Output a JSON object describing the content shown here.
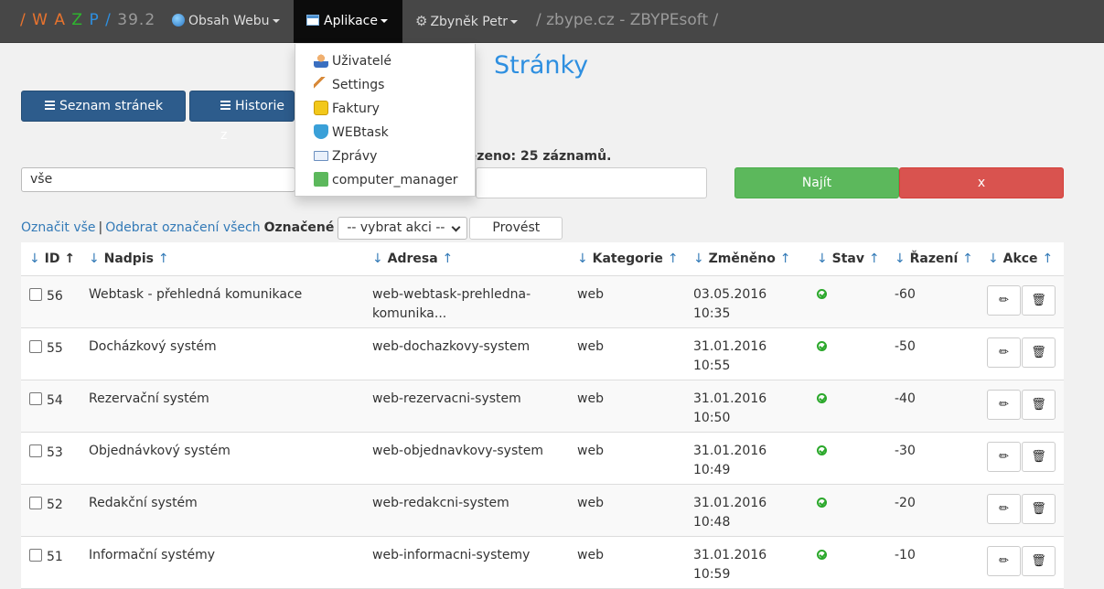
{
  "nav": {
    "brand_letters": [
      "W",
      "A",
      "Z",
      "P"
    ],
    "brand_colors": [
      "#e8732e",
      "#e8732e",
      "#2eb82e",
      "#2e8fe0"
    ],
    "version": "39.2",
    "content_menu": "Obsah Webu",
    "apps_menu": "Aplikace",
    "user_menu": "Zbyněk Petr",
    "path": "/ zbype.cz - ZBYPEsoft /"
  },
  "dropdown": {
    "items": [
      {
        "label": "Uživatelé",
        "icon": "user-icon"
      },
      {
        "label": "Settings",
        "icon": "wrench-icon"
      },
      {
        "label": "Faktury",
        "icon": "coins-icon"
      },
      {
        "label": "WEBtask",
        "icon": "check-shield-icon"
      },
      {
        "label": "Zprávy",
        "icon": "envelope-icon"
      },
      {
        "label": "computer_manager",
        "icon": "puzzle-icon"
      }
    ]
  },
  "page": {
    "title": "Stránky",
    "tab_list": "Seznam stránek",
    "tab_history": "Historie z",
    "found_text": "lezeno: 25 záznamů.",
    "filter_value": "vše",
    "find_button": "Najít",
    "clear_button": "x"
  },
  "bulk": {
    "select_all": "Označit vše",
    "separator": "|",
    "deselect_all": "Odebrat označení všech",
    "marked_label": "Označené",
    "action_select": "-- vybrat akci --",
    "run_button": "Provést"
  },
  "table": {
    "headers": {
      "id": "ID",
      "title": "Nadpis",
      "address": "Adresa",
      "category": "Kategorie",
      "changed": "Změněno",
      "state": "Stav",
      "order": "Řazení",
      "actions": "Akce"
    },
    "arrow_down": "↓",
    "arrow_up": "↑",
    "status_color": "#2ba82b",
    "rows": [
      {
        "id": "56",
        "title": "Webtask - přehledná komunikace",
        "address_l1": "web-webtask-prehledna-",
        "address_l2": "komunika...",
        "category": "web",
        "date": "03.05.2016",
        "time": "10:35",
        "order": "-60"
      },
      {
        "id": "55",
        "title": "Docházkový systém",
        "address_l1": "web-dochazkovy-system",
        "address_l2": "",
        "category": "web",
        "date": "31.01.2016",
        "time": "10:55",
        "order": "-50"
      },
      {
        "id": "54",
        "title": "Rezervační systém",
        "address_l1": "web-rezervacni-system",
        "address_l2": "",
        "category": "web",
        "date": "31.01.2016",
        "time": "10:50",
        "order": "-40"
      },
      {
        "id": "53",
        "title": "Objednávkový systém",
        "address_l1": "web-objednavkovy-system",
        "address_l2": "",
        "category": "web",
        "date": "31.01.2016",
        "time": "10:49",
        "order": "-30"
      },
      {
        "id": "52",
        "title": "Redakční systém",
        "address_l1": "web-redakcni-system",
        "address_l2": "",
        "category": "web",
        "date": "31.01.2016",
        "time": "10:48",
        "order": "-20"
      },
      {
        "id": "51",
        "title": "Informační systémy",
        "address_l1": "web-informacni-systemy",
        "address_l2": "",
        "category": "web",
        "date": "31.01.2016",
        "time": "10:59",
        "order": "-10"
      }
    ]
  }
}
